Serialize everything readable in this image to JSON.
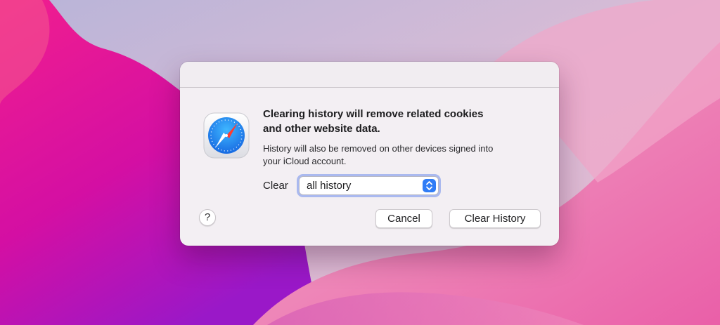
{
  "dialog": {
    "headline": [
      "Clearing history will remove related cookies",
      "and other website data."
    ],
    "detail": [
      "History will also be removed on other devices signed into",
      "your iCloud account."
    ],
    "clear_label": "Clear",
    "clear_select": {
      "selected": "all history"
    },
    "help_button": "?",
    "cancel_button": "Cancel",
    "confirm_button": "Clear History"
  },
  "icons": {
    "app": "safari-compass-icon",
    "select": "chevron-up-down-icon"
  },
  "colors": {
    "accent": "#2f7cf6",
    "focus_ring": "#6e8ceb",
    "dialog_bg": "#f3eff3",
    "wallpaper_magenta": "#e2119a",
    "wallpaper_pink": "#ef7fb9"
  }
}
